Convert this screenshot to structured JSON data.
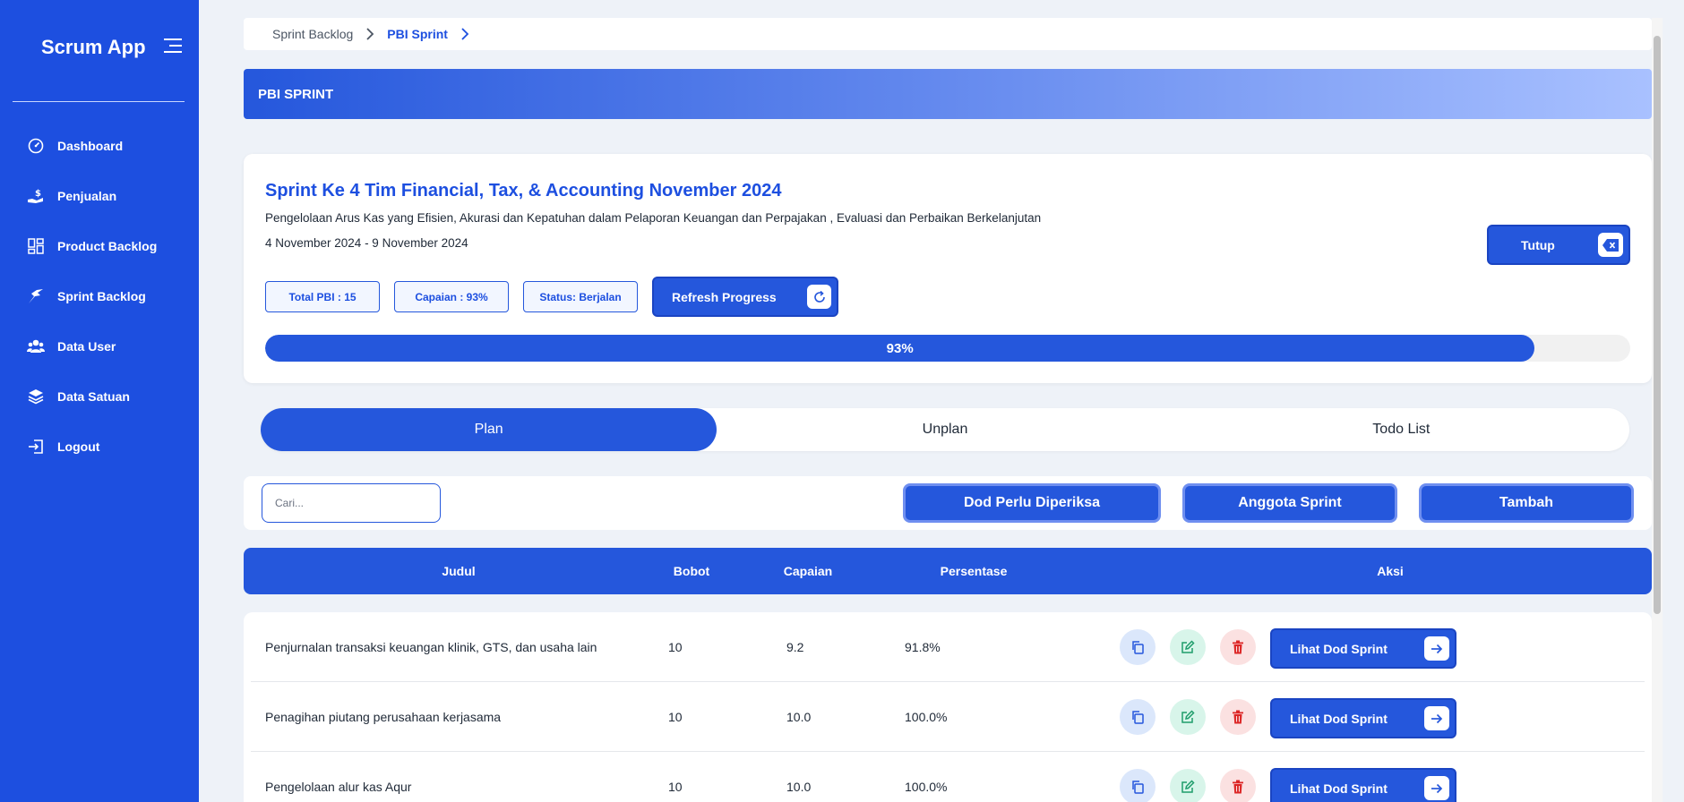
{
  "app": {
    "brand": "Scrum App"
  },
  "sidebar": {
    "items": [
      {
        "label": "Dashboard",
        "icon": "dashboard-gauge-icon"
      },
      {
        "label": "Penjualan",
        "icon": "hand-dollar-icon"
      },
      {
        "label": "Product Backlog",
        "icon": "grid-icon"
      },
      {
        "label": "Sprint Backlog",
        "icon": "sprint-run-icon"
      },
      {
        "label": "Data User",
        "icon": "users-icon"
      },
      {
        "label": "Data Satuan",
        "icon": "layers-icon"
      },
      {
        "label": "Logout",
        "icon": "logout-icon"
      }
    ]
  },
  "breadcrumb": {
    "items": [
      "Sprint Backlog",
      "PBI Sprint"
    ]
  },
  "header": {
    "title": "PBI SPRINT"
  },
  "sprint": {
    "title": "Sprint Ke 4 Tim Financial, Tax, & Accounting November 2024",
    "description": "Pengelolaan Arus Kas yang Efisien, Akurasi dan Kepatuhan dalam Pelaporan Keuangan dan Perpajakan , Evaluasi dan Perbaikan Berkelanjutan",
    "dates": "4 November 2024 - 9 November 2024",
    "total_pbi": "Total PBI : 15",
    "capaian": "Capaian : 93%",
    "status": "Status: Berjalan",
    "refresh_label": "Refresh Progress",
    "close_label": "Tutup",
    "progress": 93,
    "progress_label": "93%"
  },
  "tabs": [
    {
      "label": "Plan",
      "active": true
    },
    {
      "label": "Unplan",
      "active": false
    },
    {
      "label": "Todo List",
      "active": false
    }
  ],
  "toolbar": {
    "search_placeholder": "Cari...",
    "dod_label": "Dod Perlu Diperiksa",
    "members_label": "Anggota Sprint",
    "add_label": "Tambah"
  },
  "table": {
    "headers": [
      "Judul",
      "Bobot",
      "Capaian",
      "Persentase",
      "Aksi"
    ],
    "view_label": "Lihat Dod Sprint",
    "rows": [
      {
        "judul": "Penjurnalan transaksi keuangan klinik, GTS, dan usaha lain",
        "bobot": "10",
        "capaian": "9.2",
        "persentase": "91.8%"
      },
      {
        "judul": "Penagihan piutang perusahaan kerjasama",
        "bobot": "10",
        "capaian": "10.0",
        "persentase": "100.0%"
      },
      {
        "judul": "Pengelolaan alur kas Aqur",
        "bobot": "10",
        "capaian": "10.0",
        "persentase": "100.0%"
      }
    ]
  },
  "colors": {
    "primary": "#2557dc",
    "sidebar": "#1d4fe0",
    "background": "#eef2f8"
  }
}
